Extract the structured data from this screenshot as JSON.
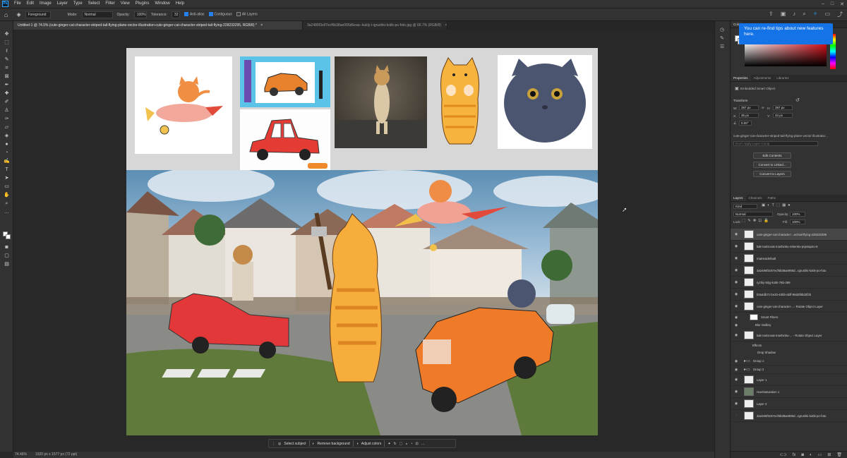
{
  "app": {
    "menu": [
      "File",
      "Edit",
      "Image",
      "Layer",
      "Type",
      "Select",
      "Filter",
      "View",
      "Plugins",
      "Window",
      "Help"
    ],
    "logo": "Ps"
  },
  "options": {
    "fill_source": "Foreground",
    "mode_label": "Mode:",
    "mode_value": "Normal",
    "opacity_label": "Opacity:",
    "opacity_value": "100%",
    "tolerance_label": "Tolerance:",
    "tolerance_value": "32",
    "antialias": "Anti-alias",
    "contiguous": "Contiguous",
    "all_layers": "All Layers"
  },
  "tabs": [
    {
      "label": "Untitled-1 @ 74.5% (cute-ginger-cat-character-striped-tail-flying-plane-vector-illustration-cute-ginger-cat-character-striped-tail-flying-228233295, RGB/8) *",
      "close": "×"
    },
    {
      "label": "3a2486f3c87ecf6b38ae995d6eaa--kukly-i-igrushki-kotik-po-foto.jpg @ 66.7% (RGB/8)",
      "close": "×"
    }
  ],
  "context_bar": {
    "select_subject": "Select subject",
    "remove_background": "Remove background",
    "adjust_colors": "Adjust colors"
  },
  "status": {
    "zoom": "74.46%",
    "doc_size": "1920 px x 1577 px (72 ppi)"
  },
  "tooltip": "You can re-find tips about new features here.",
  "color_tab": "Colo",
  "properties": {
    "tabs": [
      "Properties",
      "Adjustments",
      "Libraries"
    ],
    "layer_type": "Embedded Smart Object",
    "transform_label": "Transform",
    "w_label": "W:",
    "w_value": "397 px",
    "h_label": "H:",
    "h_value": "397 px",
    "x_label": "X:",
    "x_value": "35 px",
    "y_label": "Y:",
    "y_value": "34 px",
    "angle_value": "0.00°",
    "filename": "cute-ginger-cat-character-striped-tail-flying-plane-vector-illustratio...",
    "comp_placeholder": "Don't Apply Layer Comp",
    "edit_contents": "Edit Contents",
    "convert_linked": "Convert to Linked...",
    "convert_layers": "Convert to Layers"
  },
  "layers": {
    "tabs": [
      "Layers",
      "Channels",
      "Paths"
    ],
    "kind_filter": "Kind",
    "blend_mode": "Normal",
    "opacity_label": "Opacity:",
    "opacity_value": "100%",
    "lock_label": "Lock:",
    "fill_label": "Fill:",
    "fill_value": "100%",
    "items": [
      {
        "name": "cute-ginger-cat-character-...ed-tail-flying-228233295",
        "selected": true
      },
      {
        "name": "kak-narisovat-mashinku-rebenku-pojetapno-8",
        "selected": false
      },
      {
        "name": "mameadefault",
        "selected": false
      },
      {
        "name": "3a2486f3c87ecf6b38ae995d...rgrushki-kotik-po-foto",
        "selected": false
      },
      {
        "name": "ryzhij-milyj-kotik-76b-399",
        "selected": false
      },
      {
        "name": "b3a4db7c-be20-43bb-abff-86d2f8bd2f2b",
        "selected": false
      },
      {
        "name": "cute-ginger-cat-character-...- Rotate Object Layer",
        "selected": false
      }
    ],
    "smart_filters": "Smart Filters",
    "blur_gallery": "Blur Gallery",
    "rotate_layer_2": "kak-narisovat-mashinku-... - Rotate Object Layer",
    "effects": "Effects",
    "drop_shadow": "Drop Shadow",
    "lower_items": [
      "Group 1",
      "Group 2",
      "Layer 1",
      "Hue/Saturation 1",
      "Layer 2",
      "3a2486f3c87ecf6b38ae995d...rgrushki-kotik-po-foto"
    ]
  }
}
